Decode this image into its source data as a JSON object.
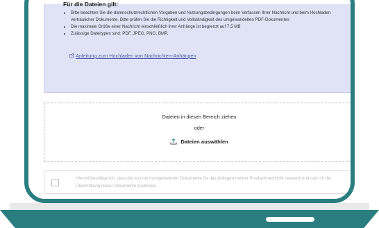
{
  "info": {
    "heading": "Für die Dateien gilt:",
    "bullets": [
      "Bitte beachten Sie die datenschutzrechtlichen Vorgaben und Nutzungsbedingungen beim Verfassen Ihrer Nachricht und beim Hochladen vertraulicher Dokumente. Bitte prüfen Sie die Richtigkeit und Vollständigkeit des umgewandelten PDF-Dokumentes",
      "Die maximale Größe einer Nachricht einschließlich ihrer Anhänge ist begrenzt auf 7,5 MB",
      "Zulässige Dateitypen sind: PDF, JPEG, PNG, BMP."
    ],
    "link_label": "Anleitung zum Hochladen von Nachrichten-Anhängen",
    "link_icon": "external-link-icon"
  },
  "dropzone": {
    "line1": "Dateien in diesen Bereich ziehen",
    "line2": "oder",
    "button_label": "Dateien auswählen",
    "button_icon": "upload-icon"
  },
  "confirmation": {
    "checked": false,
    "text": "Hiermit bestätige ich, dass die von mir hochgeladenen Dokumente für das Anliegen meiner Postfachnachricht relevant sind und ich der Übermittlung dieser Dokumente zustimme."
  },
  "colors": {
    "frame": "#2a7e80",
    "info_background": "#dfe3f5",
    "link": "#4a5aa8"
  }
}
